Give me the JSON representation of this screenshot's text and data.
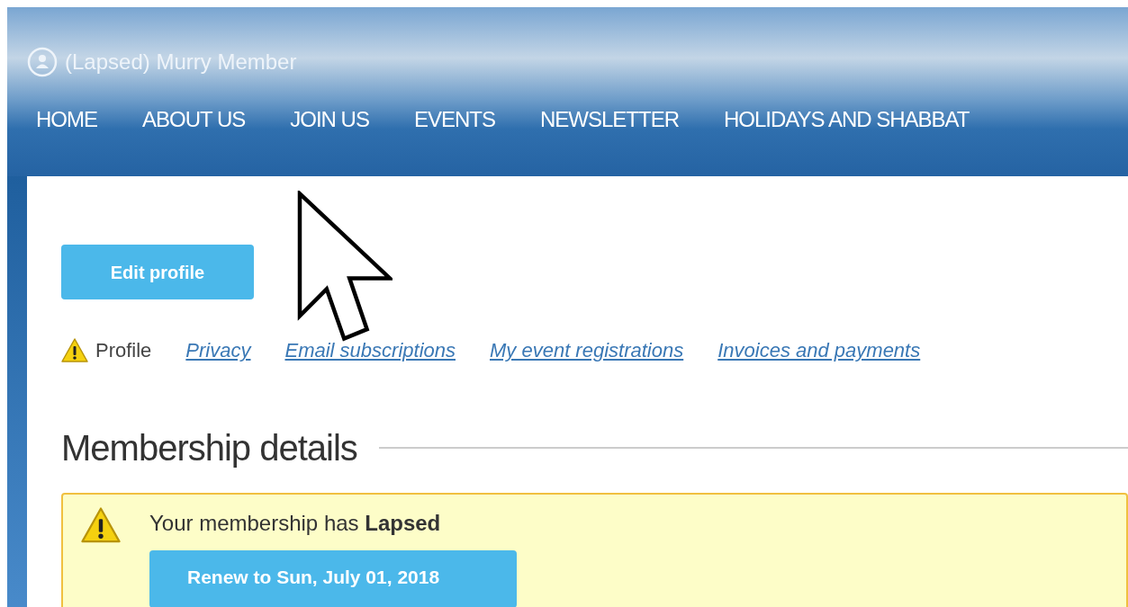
{
  "user": {
    "name": "(Lapsed) Murry Member"
  },
  "nav": [
    {
      "label": "HOME"
    },
    {
      "label": "ABOUT US"
    },
    {
      "label": "JOIN US"
    },
    {
      "label": "EVENTS"
    },
    {
      "label": "NEWSLETTER"
    },
    {
      "label": "HOLIDAYS AND SHABBAT"
    }
  ],
  "edit_button": "Edit profile",
  "tabs": [
    {
      "label": "Profile",
      "selected": true,
      "warning": true
    },
    {
      "label": "Privacy",
      "selected": false,
      "warning": false
    },
    {
      "label": "Email subscriptions",
      "selected": false,
      "warning": false
    },
    {
      "label": "My event registrations",
      "selected": false,
      "warning": false
    },
    {
      "label": "Invoices and payments",
      "selected": false,
      "warning": false
    }
  ],
  "section": {
    "title": "Membership details"
  },
  "alert": {
    "message": "Your membership has **Lapsed**",
    "button": "Renew to Sun, July 01, 2018"
  }
}
